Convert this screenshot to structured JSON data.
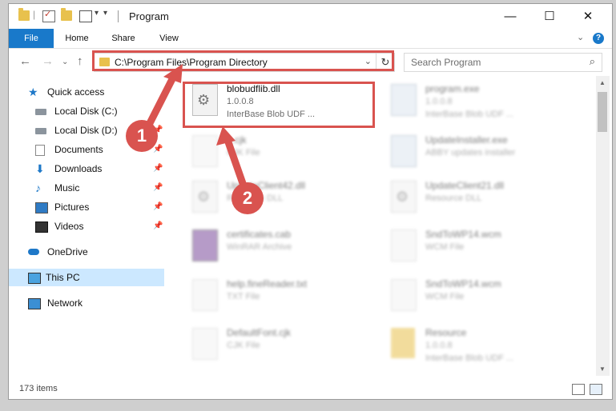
{
  "window": {
    "title": "Program",
    "controls": {
      "minimize": "—",
      "maximize": "☐",
      "close": "✕"
    }
  },
  "ribbon": {
    "tabs": [
      "File",
      "Home",
      "Share",
      "View"
    ],
    "help": "?"
  },
  "address_bar": {
    "path": "C:\\Program Files\\Program Directory"
  },
  "search": {
    "placeholder": "Search Program"
  },
  "sidebar": {
    "items": [
      {
        "label": "Quick access",
        "icon": "star-icon"
      },
      {
        "label": "Local Disk (C:)",
        "icon": "disk-icon",
        "pinned": true
      },
      {
        "label": "Local Disk (D:)",
        "icon": "disk-icon",
        "pinned": true
      },
      {
        "label": "Documents",
        "icon": "documents-icon",
        "pinned": true
      },
      {
        "label": "Downloads",
        "icon": "downloads-icon",
        "pinned": true
      },
      {
        "label": "Music",
        "icon": "music-icon",
        "pinned": true
      },
      {
        "label": "Pictures",
        "icon": "pictures-icon",
        "pinned": true
      },
      {
        "label": "Videos",
        "icon": "videos-icon",
        "pinned": true
      },
      {
        "label": "OneDrive",
        "icon": "onedrive-icon"
      },
      {
        "label": "This PC",
        "icon": "pc-icon",
        "selected": true
      },
      {
        "label": "Network",
        "icon": "network-icon"
      }
    ]
  },
  "files": [
    {
      "name": "blobudflib.dll",
      "meta1": "1.0.0.8",
      "meta2": "InterBase Blob UDF ...",
      "icon": "dll-gear-icon",
      "highlighted": true
    },
    {
      "name": "program.exe",
      "meta1": "1.0.0.8",
      "meta2": "InterBase Blob UDF ...",
      "icon": "exe-icon"
    },
    {
      "name": "...cjk",
      "meta1": "CJK File",
      "meta2": "",
      "icon": "document-icon"
    },
    {
      "name": "UpdateInstaller.exe",
      "meta1": "ABBY updates installer",
      "meta2": "",
      "icon": "exe-icon"
    },
    {
      "name": "UpdateClient42.dll",
      "meta1": "Resource DLL",
      "meta2": "",
      "icon": "dll-gear-icon"
    },
    {
      "name": "UpdateClient21.dll",
      "meta1": "Resource DLL",
      "meta2": "",
      "icon": "dll-gear-icon"
    },
    {
      "name": "certificates.cab",
      "meta1": "WinRAR Archive",
      "meta2": "",
      "icon": "archive-icon"
    },
    {
      "name": "SndToWP14.wcm",
      "meta1": "WCM File",
      "meta2": "",
      "icon": "document-icon"
    },
    {
      "name": "help.fineReader.txt",
      "meta1": "TXT File",
      "meta2": "",
      "icon": "document-icon"
    },
    {
      "name": "SndToWP14.wcm",
      "meta1": "WCM File",
      "meta2": "",
      "icon": "document-icon"
    },
    {
      "name": "DefaultFont.cjk",
      "meta1": "CJK File",
      "meta2": "",
      "icon": "document-icon"
    },
    {
      "name": "Resource",
      "meta1": "1.0.0.8",
      "meta2": "InterBase Blob UDF ...",
      "icon": "folder-icon"
    }
  ],
  "status": {
    "item_count": "173 items"
  },
  "annotations": {
    "step1": "1",
    "step2": "2"
  },
  "colors": {
    "accent": "#1979ca",
    "highlight": "#d9534f",
    "selected": "#cce8ff"
  }
}
